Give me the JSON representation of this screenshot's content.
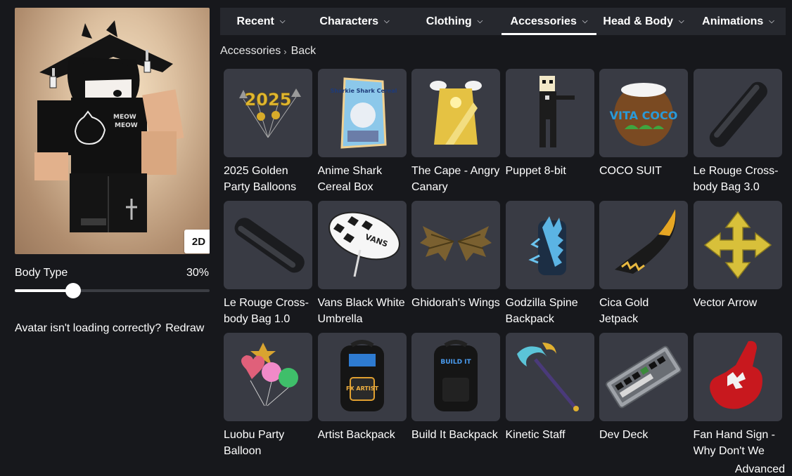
{
  "avatar": {
    "shirt_text_line1": "MEOW",
    "shirt_text_line2": "MEOW",
    "view_toggle": "2D"
  },
  "body_type": {
    "label": "Body Type",
    "value_text": "30%",
    "value": 0.3
  },
  "avatar_issue": {
    "text": "Avatar isn't loading correctly?",
    "link": "Redraw"
  },
  "tabs": [
    {
      "label": "Recent",
      "active": false
    },
    {
      "label": "Characters",
      "active": false
    },
    {
      "label": "Clothing",
      "active": false
    },
    {
      "label": "Accessories",
      "active": true
    },
    {
      "label": "Head & Body",
      "active": false
    },
    {
      "label": "Animations",
      "active": false
    }
  ],
  "breadcrumb": {
    "parent": "Accessories",
    "current": "Back"
  },
  "items": [
    {
      "name": "2025 Golden Party Balloons",
      "icon": "golden-balloons-icon",
      "thumb_text": "2025"
    },
    {
      "name": "Anime Shark Cereal Box",
      "icon": "cereal-box-icon",
      "thumb_text": "Sharkie Shark Cereal"
    },
    {
      "name": "The Cape - Angry Canary",
      "icon": "cape-icon"
    },
    {
      "name": "Puppet 8-bit",
      "icon": "puppet-icon"
    },
    {
      "name": "COCO SUIT",
      "icon": "coconut-icon",
      "thumb_text": "VITA COCO"
    },
    {
      "name": "Le Rouge Cross-body Bag 3.0",
      "icon": "crossbody-bag-icon"
    },
    {
      "name": "Le Rouge Cross-body Bag 1.0",
      "icon": "crossbody-bag-icon"
    },
    {
      "name": "Vans Black White Umbrella",
      "icon": "umbrella-icon",
      "thumb_text": "VANS"
    },
    {
      "name": "Ghidorah's Wings",
      "icon": "wings-icon"
    },
    {
      "name": "Godzilla Spine Backpack",
      "icon": "spine-backpack-icon"
    },
    {
      "name": "Cica Gold Jetpack",
      "icon": "jetpack-icon"
    },
    {
      "name": "Vector Arrow",
      "icon": "arrow-icon"
    },
    {
      "name": "Luobu Party Balloon",
      "icon": "party-balloon-icon"
    },
    {
      "name": "Artist Backpack",
      "icon": "backpack-icon",
      "thumb_text": "FX ARTIST"
    },
    {
      "name": "Build It Backpack",
      "icon": "backpack-icon",
      "thumb_text": "BUILD IT"
    },
    {
      "name": "Kinetic Staff",
      "icon": "staff-icon"
    },
    {
      "name": "Dev Deck",
      "icon": "keyboard-icon"
    },
    {
      "name": "Fan Hand Sign - Why Don't We",
      "icon": "foam-hand-icon"
    }
  ],
  "advanced_link": "Advanced",
  "colors": {
    "background": "#17181c",
    "tab_bar": "#26282e",
    "card": "#393b44",
    "text": "#ffffff"
  }
}
